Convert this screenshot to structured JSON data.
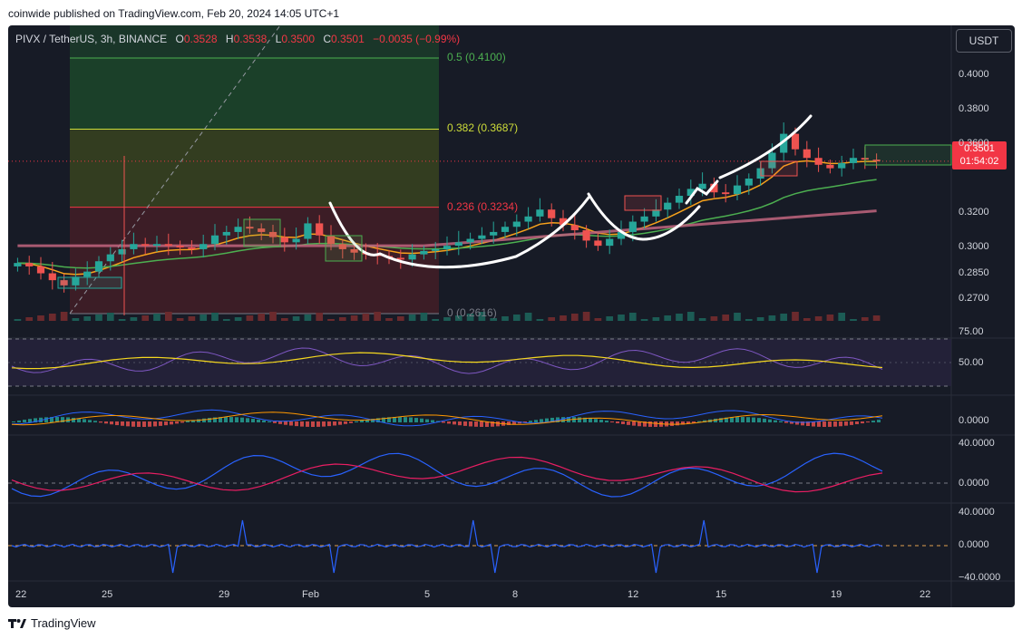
{
  "header": {
    "publisher": "coinwide published on TradingView.com, Feb 20, 2024 14:05 UTC+1"
  },
  "footer": {
    "brand": "TradingView"
  },
  "chart_data": {
    "type": "candlestick",
    "symbol": "PIVX / TetherUS, 3h, BINANCE",
    "ohlc": {
      "O": "0.3528",
      "H": "0.3538",
      "L": "0.3500",
      "C": "0.3501",
      "change": "−0.0035 (−0.99%)"
    },
    "currency": "USDT",
    "last_price": "0.3501",
    "countdown": "01:54:02",
    "price_axis": [
      "0.4000",
      "0.3800",
      "0.3600",
      "0.3200",
      "0.3000",
      "0.2850",
      "0.2700"
    ],
    "price_range": [
      0.2616,
      0.41
    ],
    "date_axis": [
      "22",
      "25",
      "29",
      "Feb",
      "5",
      "8",
      "12",
      "15",
      "19",
      "22"
    ],
    "fib_levels": [
      {
        "label": "0.5 (0.4100)",
        "value": 0.41,
        "color": "#4caf50"
      },
      {
        "label": "0.382 (0.3687)",
        "value": 0.3687,
        "color": "#cddc39"
      },
      {
        "label": "0.236 (0.3234)",
        "value": 0.3234,
        "color": "#f23645"
      },
      {
        "label": "0 (0.2616)",
        "value": 0.2616,
        "color": "#787b86"
      }
    ],
    "close_series": [
      0.291,
      0.289,
      0.285,
      0.281,
      0.278,
      0.283,
      0.286,
      0.292,
      0.296,
      0.299,
      0.302,
      0.301,
      0.302,
      0.301,
      0.3,
      0.299,
      0.302,
      0.307,
      0.309,
      0.312,
      0.311,
      0.309,
      0.306,
      0.303,
      0.305,
      0.314,
      0.307,
      0.302,
      0.299,
      0.297,
      0.296,
      0.295,
      0.294,
      0.293,
      0.296,
      0.298,
      0.299,
      0.301,
      0.303,
      0.305,
      0.307,
      0.309,
      0.312,
      0.315,
      0.318,
      0.322,
      0.317,
      0.313,
      0.31,
      0.304,
      0.301,
      0.305,
      0.309,
      0.315,
      0.318,
      0.322,
      0.326,
      0.33,
      0.334,
      0.337,
      0.332,
      0.331,
      0.336,
      0.34,
      0.346,
      0.355,
      0.366,
      0.357,
      0.352,
      0.348,
      0.346,
      0.349,
      0.352,
      0.351,
      0.35
    ],
    "indicator_axes": {
      "rsi": [
        "75.00",
        "50.00"
      ],
      "macd": [
        "0.0000"
      ],
      "adx": [
        "40.0000",
        "0.0000"
      ],
      "osc": [
        "40.0000",
        "0.0000",
        "−40.0000"
      ]
    }
  }
}
